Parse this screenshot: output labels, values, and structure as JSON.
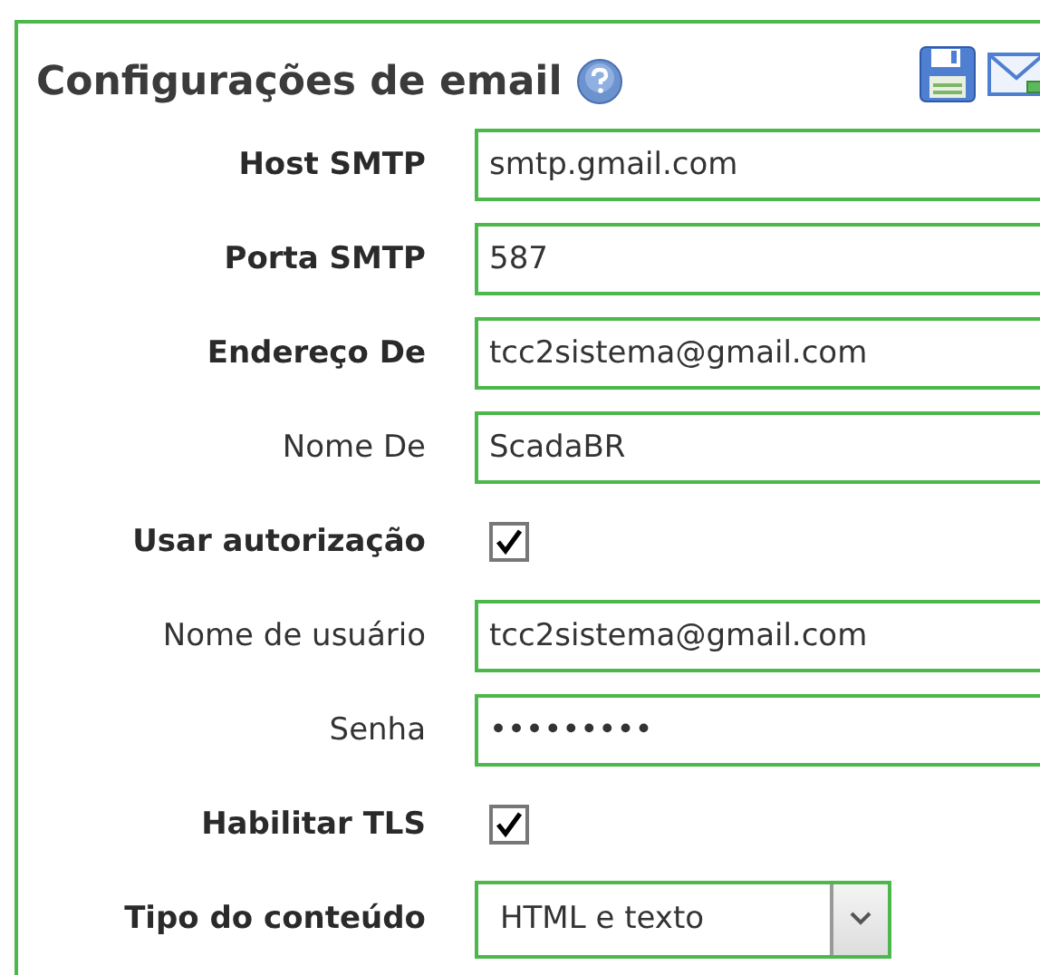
{
  "panel": {
    "title": "Configurações de email"
  },
  "fields": [
    {
      "label": "Host SMTP",
      "bold": true,
      "kind": "text",
      "value": "smtp.gmail.com"
    },
    {
      "label": "Porta SMTP",
      "bold": true,
      "kind": "text",
      "value": "587"
    },
    {
      "label": "Endereço De",
      "bold": true,
      "kind": "text",
      "value": "tcc2sistema@gmail.com"
    },
    {
      "label": "Nome De",
      "bold": false,
      "kind": "text",
      "value": "ScadaBR"
    },
    {
      "label": "Usar autorização",
      "bold": true,
      "kind": "checkbox",
      "checked": true
    },
    {
      "label": "Nome de usuário",
      "bold": false,
      "kind": "text",
      "value": "tcc2sistema@gmail.com"
    },
    {
      "label": "Senha",
      "bold": false,
      "kind": "password",
      "value": "•••••••••"
    },
    {
      "label": "Habilitar TLS",
      "bold": true,
      "kind": "checkbox",
      "checked": true
    },
    {
      "label": "Tipo do conteúdo",
      "bold": true,
      "kind": "select",
      "value": "HTML e texto"
    }
  ]
}
